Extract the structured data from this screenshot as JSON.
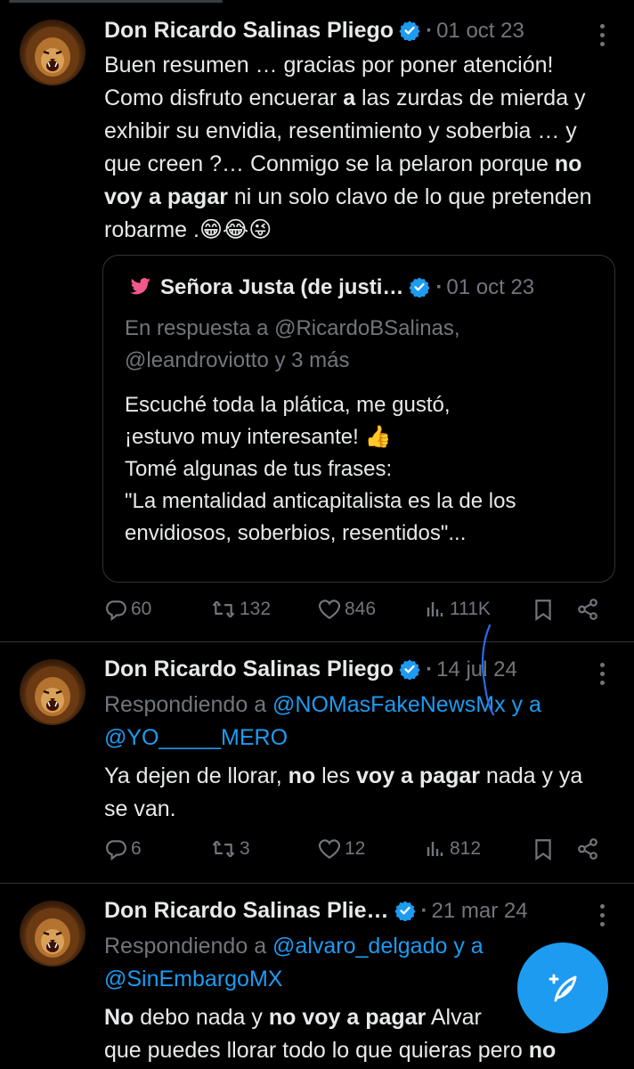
{
  "tweets": [
    {
      "author": "Don Ricardo Salinas Pliego",
      "date": "01 oct 23",
      "body_parts": [
        "Buen resumen … gracias por poner atención! Como disfruto encuerar ",
        "a",
        " las zurdas de mierda y exhibir su envidia, resentimiento y soberbia … y que creen ?… Conmigo se la pelaron porque ",
        "no voy a pagar",
        " ni un solo clavo de lo que pretenden robarme .",
        "😁😂😜"
      ],
      "quote": {
        "author": "Señora Justa (de justi…",
        "date": "01 oct 23",
        "reply_line1": "En respuesta a @RicardoBSalinas,",
        "reply_line2": "@leandroviotto y 3 más",
        "text_line1": "Escuché toda la plática, me gustó,",
        "text_line2": "¡estuvo muy interesante! 👍",
        "text_line3": "Tomé algunas de tus frases:",
        "text_line4": "\"La mentalidad anticapitalista es la de los",
        "text_line5": "envidiosos, soberbios, resentidos\"..."
      },
      "stats": {
        "replies": "60",
        "retweets": "132",
        "likes": "846",
        "views": "111K"
      }
    },
    {
      "author": "Don Ricardo Salinas Pliego",
      "date": "14 jul 24",
      "replying_prefix": "Respondiendo a ",
      "mention1": "@NOMasFakeNewsMx y a",
      "mention2": "@YO_____MERO",
      "body_parts": [
        "Ya dejen de llorar, ",
        "no",
        " les ",
        "voy a pagar",
        " nada y ya se van."
      ],
      "stats": {
        "replies": "6",
        "retweets": "3",
        "likes": "12",
        "views": "812"
      }
    },
    {
      "author": "Don Ricardo Salinas Plie…",
      "date": "21 mar 24",
      "replying_prefix": "Respondiendo a ",
      "mention1": "@alvaro_delgado y a",
      "mention2": "@SinEmbargoMX",
      "body_parts": [
        "No",
        " debo nada y ",
        "no voy a pagar",
        " Alvar",
        "que puedes llorar todo lo que quieras pero ",
        "no"
      ]
    }
  ],
  "separator": "·",
  "colors": {
    "accent": "#1d9bf0",
    "muted": "#71767b",
    "text": "#e7e9ea",
    "background": "#000000"
  },
  "icons": [
    "verified-icon",
    "more-icon",
    "reply-icon",
    "retweet-icon",
    "like-icon",
    "views-icon",
    "bookmark-icon",
    "share-icon",
    "compose-icon",
    "twitter-bird-icon"
  ]
}
